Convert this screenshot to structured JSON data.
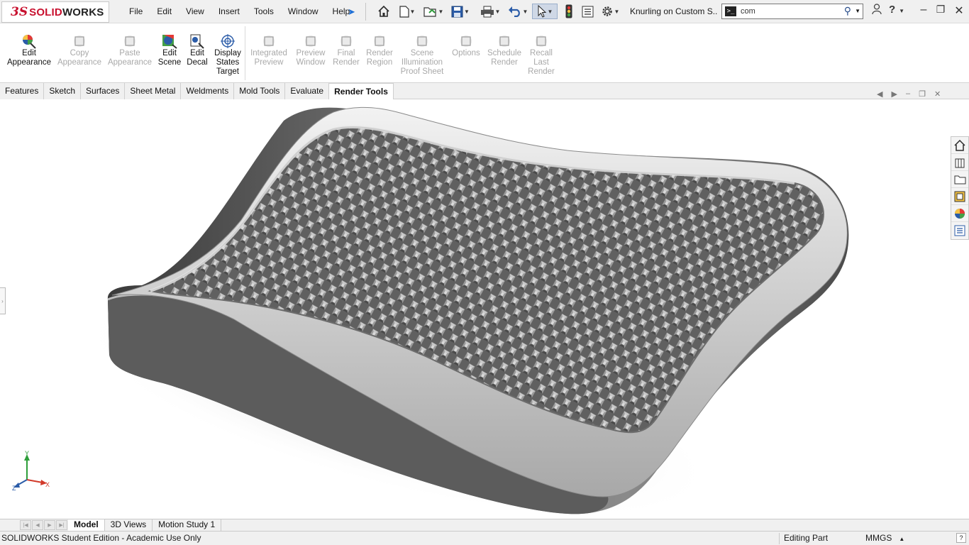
{
  "app": {
    "brand_prefix": "3S",
    "brand_red": "SOLID",
    "brand_dark": "WORKS",
    "accent": "#c8102e"
  },
  "menu": [
    "File",
    "Edit",
    "View",
    "Insert",
    "Tools",
    "Window",
    "Help"
  ],
  "quick_access_icons": [
    "home-icon",
    "new-document-icon",
    "open-icon",
    "save-icon",
    "print-icon",
    "undo-icon",
    "select-icon",
    "traffic-light-icon",
    "file-properties-icon",
    "options-gear-icon"
  ],
  "document_title": "Knurling on Custom S...",
  "search": {
    "value": "com"
  },
  "ribbon": {
    "buttons": [
      {
        "label": "Edit\nAppearance",
        "enabled": true,
        "icon": "edit-appearance-icon"
      },
      {
        "label": "Copy\nAppearance",
        "enabled": false,
        "icon": "copy-appearance-icon"
      },
      {
        "label": "Paste\nAppearance",
        "enabled": false,
        "icon": "paste-appearance-icon"
      },
      {
        "label": "Edit\nScene",
        "enabled": true,
        "icon": "edit-scene-icon"
      },
      {
        "label": "Edit\nDecal",
        "enabled": true,
        "icon": "edit-decal-icon"
      },
      {
        "label": "Display\nStates\nTarget",
        "enabled": true,
        "icon": "display-states-target-icon"
      },
      {
        "label": "Integrated\nPreview",
        "enabled": false,
        "icon": "integrated-preview-icon"
      },
      {
        "label": "Preview\nWindow",
        "enabled": false,
        "icon": "preview-window-icon"
      },
      {
        "label": "Final\nRender",
        "enabled": false,
        "icon": "final-render-icon"
      },
      {
        "label": "Render\nRegion",
        "enabled": false,
        "icon": "render-region-icon"
      },
      {
        "label": "Scene\nIllumination\nProof Sheet",
        "enabled": false,
        "icon": "scene-illumination-icon"
      },
      {
        "label": "Options",
        "enabled": false,
        "icon": "options-icon"
      },
      {
        "label": "Schedule\nRender",
        "enabled": false,
        "icon": "schedule-render-icon"
      },
      {
        "label": "Recall\nLast\nRender",
        "enabled": false,
        "icon": "recall-last-render-icon"
      }
    ]
  },
  "command_tabs": [
    "Features",
    "Sketch",
    "Surfaces",
    "Sheet Metal",
    "Weldments",
    "Mold Tools",
    "Evaluate",
    "Render Tools"
  ],
  "active_command_tab": "Render Tools",
  "triad": {
    "x": "X",
    "y": "Y",
    "z": "Z"
  },
  "task_pane_icons": [
    "solidworks-resources-icon",
    "design-library-icon",
    "file-explorer-icon",
    "view-palette-icon",
    "appearances-icon",
    "custom-properties-icon"
  ],
  "doc_tabs": [
    "Model",
    "3D Views",
    "Motion Study 1"
  ],
  "active_doc_tab": "Model",
  "status": {
    "left": "SOLIDWORKS Student Edition - Academic Use Only",
    "mode": "Editing Part",
    "units": "MMGS"
  }
}
